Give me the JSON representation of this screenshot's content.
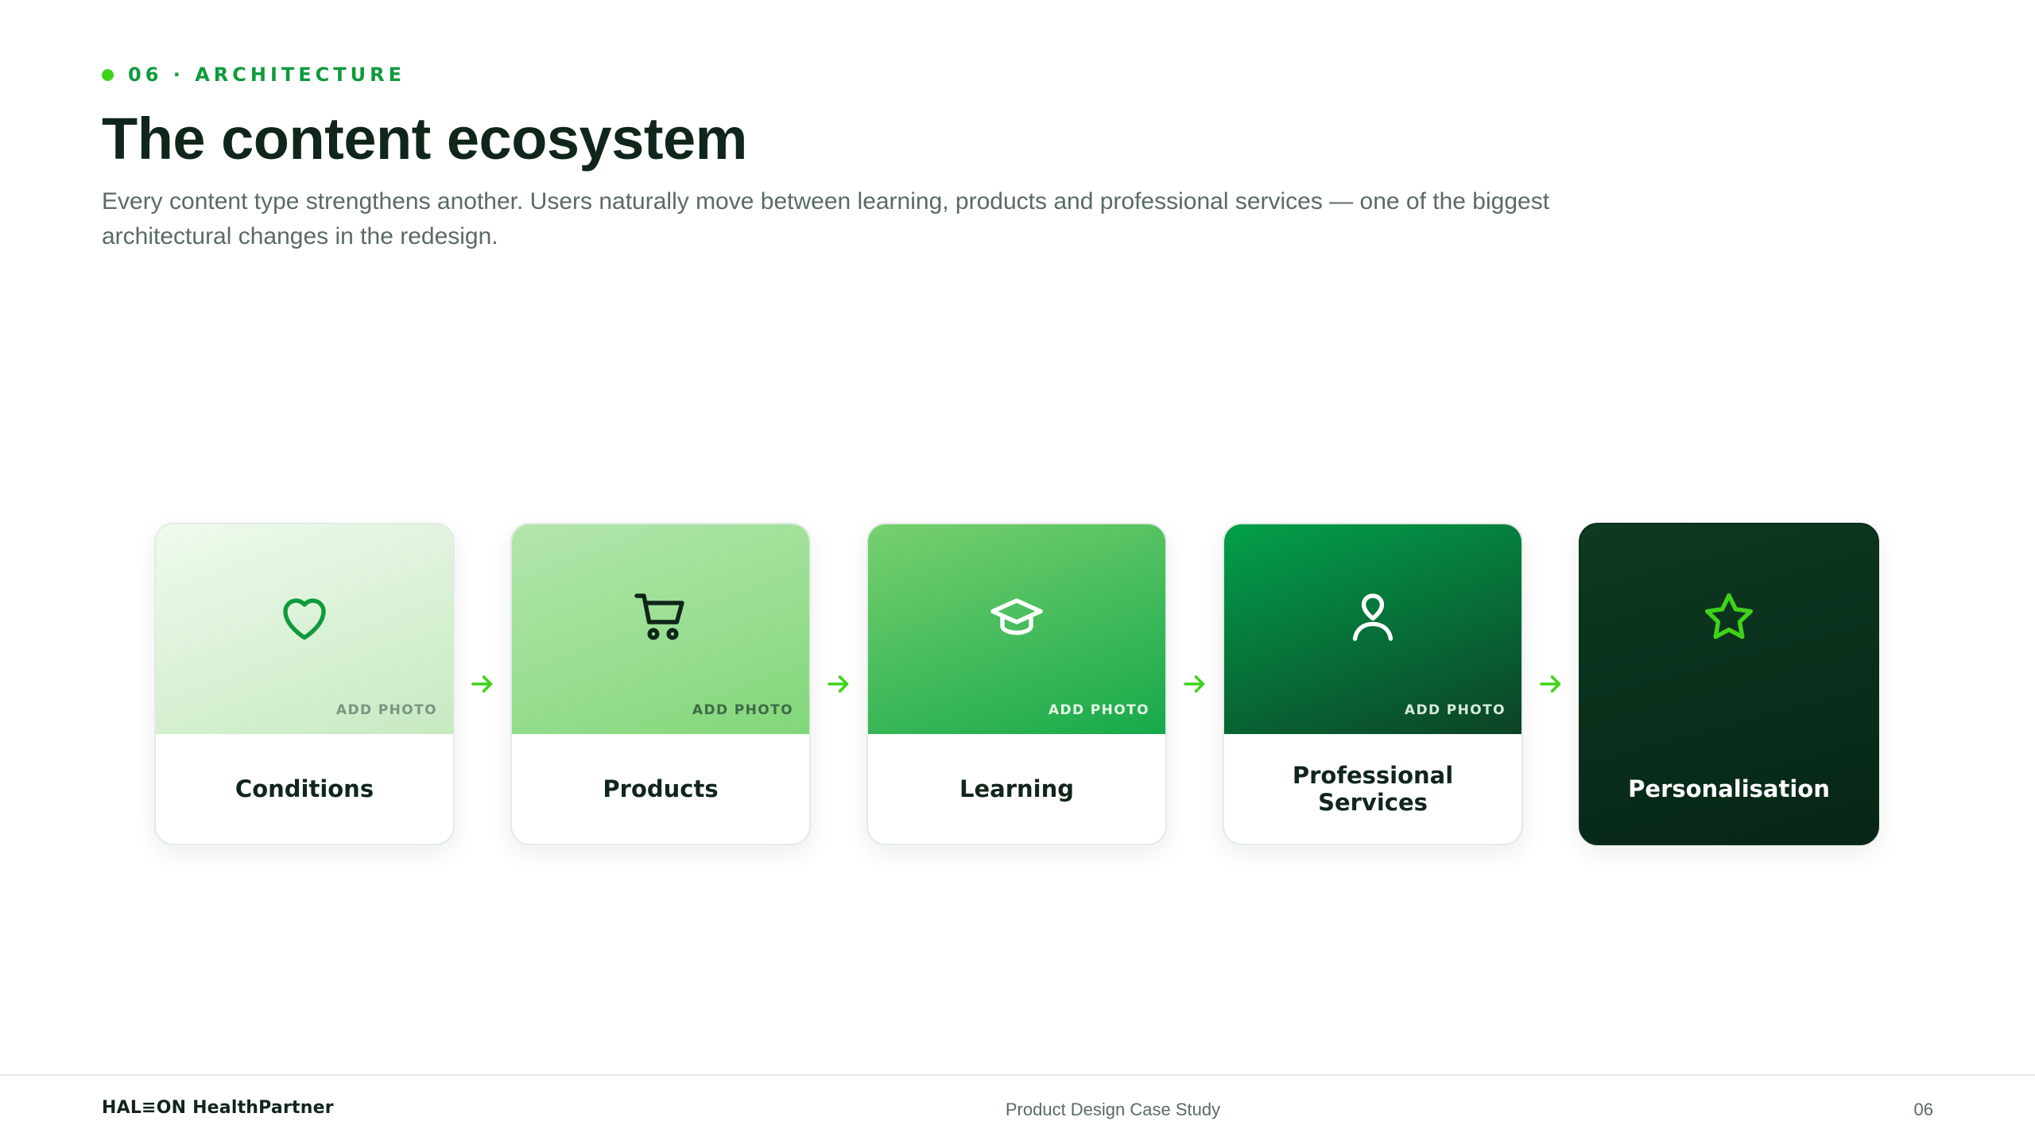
{
  "header": {
    "eyebrow": "06 · ARCHITECTURE",
    "title": "The content ecosystem",
    "subtitle": "Every content type strengthens another. Users naturally move between learning, products and professional services — one of the biggest architectural changes in the redesign."
  },
  "flow": {
    "cards": [
      {
        "label": "Conditions",
        "icon": "heart-icon",
        "photo_label": "ADD PHOTO",
        "icon_color": "#0f9a3c",
        "photo_color": "#7a9680"
      },
      {
        "label": "Products",
        "icon": "cart-icon",
        "photo_label": "ADD PHOTO",
        "icon_color": "#10261a",
        "photo_color": "#3f6a47"
      },
      {
        "label": "Learning",
        "icon": "graduation-cap-icon",
        "photo_label": "ADD PHOTO",
        "icon_color": "#ffffff",
        "photo_color": "#e6f6e6"
      },
      {
        "label": "Professional Services",
        "icon": "user-icon",
        "photo_label": "ADD PHOTO",
        "icon_color": "#ffffff",
        "photo_color": "#d7eadc"
      },
      {
        "label": "Personalisation",
        "icon": "star-icon",
        "photo_label": "",
        "icon_color": "#3fd21a",
        "photo_color": ""
      }
    ],
    "arrow_color": "#3fd21a"
  },
  "footer": {
    "brand": "HAL≡ON HealthPartner",
    "center": "Product Design Case Study",
    "page": "06"
  },
  "colors": {
    "accent": "#3fd21a",
    "brand_green": "#0f9a3c",
    "dark": "#10261a",
    "muted": "#5a6b61"
  }
}
